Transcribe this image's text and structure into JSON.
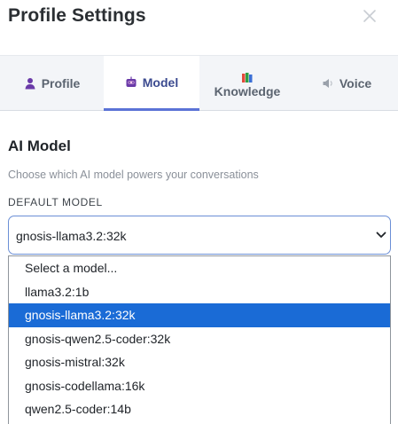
{
  "header": {
    "title": "Profile Settings"
  },
  "tabs": [
    {
      "label": "Profile",
      "icon": "person-icon"
    },
    {
      "label": "Model",
      "icon": "robot-icon"
    },
    {
      "label": "Knowledge",
      "icon": "books-icon"
    },
    {
      "label": "Voice",
      "icon": "speaker-icon"
    }
  ],
  "section": {
    "title": "AI Model",
    "description": "Choose which AI model powers your conversations",
    "field_label": "DEFAULT MODEL"
  },
  "select": {
    "value": "gnosis-llama3.2:32k",
    "options": [
      "Select a model...",
      "llama3.2:1b",
      "gnosis-llama3.2:32k",
      "gnosis-qwen2.5-coder:32k",
      "gnosis-mistral:32k",
      "gnosis-codellama:16k",
      "qwen2.5-coder:14b"
    ]
  },
  "colors": {
    "accent": "#5b73d6",
    "selected_option": "#1a6bd6"
  }
}
